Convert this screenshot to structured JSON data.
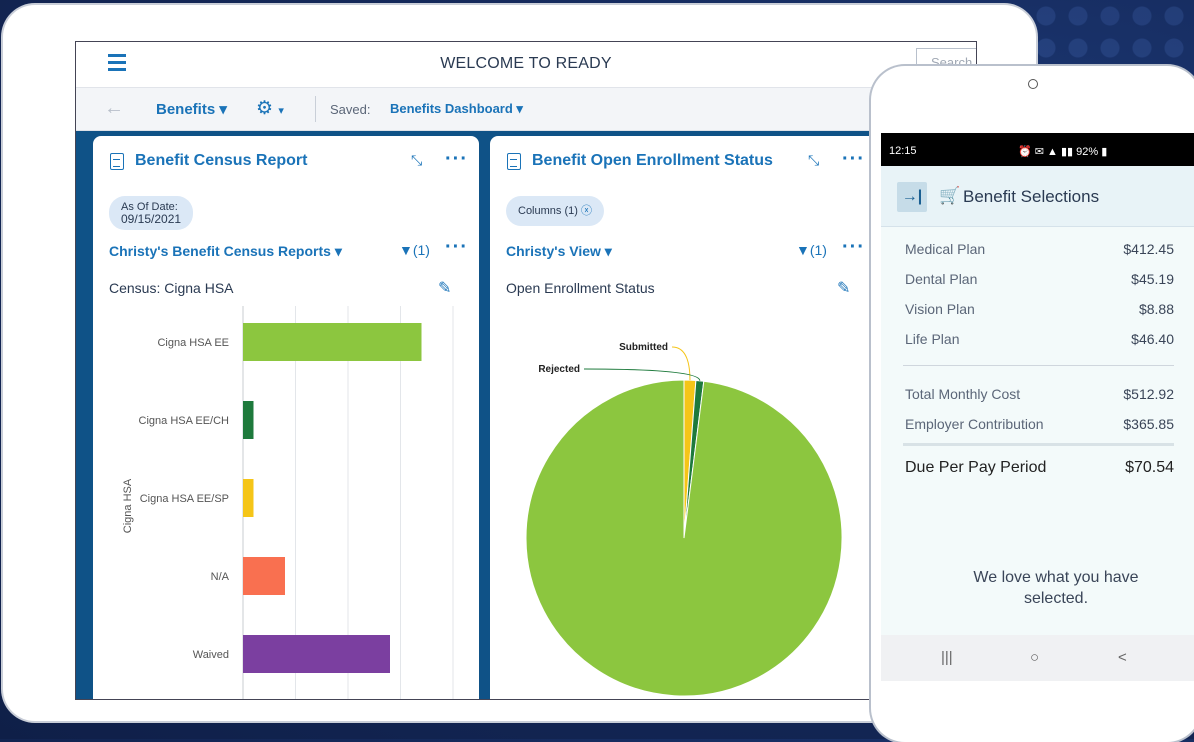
{
  "tablet": {
    "header": {
      "title": "WELCOME TO READY",
      "search_placeholder": "Search"
    },
    "nav": {
      "back_icon": "arrow-left-icon",
      "module": "Benefits",
      "settings_icon": "gear-icon",
      "saved_label": "Saved:",
      "saved_value": "Benefits Dashboard"
    },
    "census_card": {
      "title": "Benefit Census Report",
      "chip_label": "As Of Date:",
      "chip_value": "09/15/2021",
      "view": "Christy's Benefit Census Reports",
      "filter_count": "(1)",
      "subtitle": "Census: Cigna HSA"
    },
    "enrollment_card": {
      "title": "Benefit Open Enrollment Status",
      "chip_label": "Columns (1)",
      "view": "Christy's View",
      "filter_count": "(1)",
      "subtitle": "Open Enrollment Status"
    }
  },
  "chart_data": [
    {
      "type": "bar",
      "orientation": "horizontal",
      "ylabel": "Cigna HSA",
      "categories": [
        "Cigna HSA EE",
        "Cigna HSA EE/CH",
        "Cigna HSA EE/SP",
        "N/A",
        "Waived"
      ],
      "values": [
        34,
        2,
        2,
        8,
        28
      ],
      "colors": [
        "#8cc63f",
        "#1e7a3c",
        "#f5c518",
        "#f97050",
        "#7b3fa0"
      ],
      "grid": true
    },
    {
      "type": "pie",
      "labels": [
        "Submitted",
        "Rejected",
        ""
      ],
      "values": [
        1.2,
        0.8,
        98
      ],
      "colors": [
        "#f5c518",
        "#1e7a3c",
        "#8cc63f"
      ]
    }
  ],
  "phone": {
    "status": {
      "time": "12:15",
      "battery": "92%"
    },
    "title": "Benefit Selections",
    "rows": [
      {
        "label": "Medical Plan",
        "value": "$412.45"
      },
      {
        "label": "Dental Plan",
        "value": "$45.19"
      },
      {
        "label": "Vision Plan",
        "value": "$8.88"
      },
      {
        "label": "Life Plan",
        "value": "$46.40"
      }
    ],
    "totals": [
      {
        "label": "Total Monthly Cost",
        "value": "$512.92"
      },
      {
        "label": "Employer Contribution",
        "value": "$365.85"
      }
    ],
    "due": {
      "label": "Due Per Pay Period",
      "value": "$70.54"
    },
    "message": "We love what you have selected.",
    "nav": {
      "recent": "|||",
      "home": "○",
      "back": "<"
    }
  }
}
